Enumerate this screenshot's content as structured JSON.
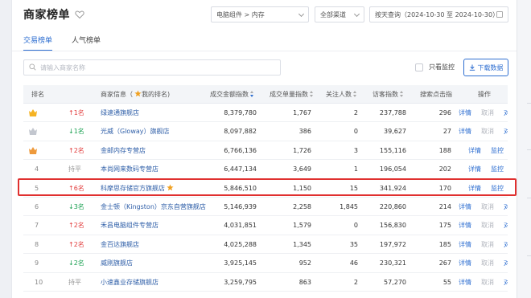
{
  "header": {
    "title": "商家榜单"
  },
  "filters": {
    "category": "电脑组件 > 内存",
    "channel": "全部渠道",
    "date": "按天查询（2024-10-30 至 2024-10-30）"
  },
  "tabs": [
    {
      "label": "交易榜单",
      "active": true
    },
    {
      "label": "人气榜单",
      "active": false
    }
  ],
  "search": {
    "placeholder": "请输入商家名称"
  },
  "toolbar": {
    "monitor_label": "只看监控",
    "download_label": "下载数据"
  },
  "table": {
    "columns": {
      "rank": "排名",
      "store": "商家信息（",
      "store_suffix": "我的排名)",
      "trade_index": "成交金额指数",
      "volume_index": "成交单量指数",
      "follow": "关注人数",
      "visitor_index": "访客指数",
      "click_index": "搜索点击指",
      "ops": "操作"
    },
    "rows": [
      {
        "rank": "1",
        "medal": "gold",
        "change": "1名",
        "dir": "up",
        "store": "绿速通旗舰店",
        "trade": "8,379,780",
        "volume": "1,767",
        "follow": "2",
        "visitor": "237,788",
        "click": "296",
        "actions": [
          "详情",
          "取消",
          "对比"
        ]
      },
      {
        "rank": "2",
        "medal": "silver",
        "change": "1名",
        "dir": "down",
        "store": "光威（Gloway）旗舰店",
        "trade": "8,097,882",
        "volume": "386",
        "follow": "0",
        "visitor": "39,627",
        "click": "27",
        "actions": [
          "详情",
          "取消",
          "对比"
        ]
      },
      {
        "rank": "3",
        "medal": "bronze",
        "change": "2名",
        "dir": "up",
        "store": "金邮内存专营店",
        "trade": "6,766,136",
        "volume": "1,726",
        "follow": "3",
        "visitor": "155,116",
        "click": "188",
        "actions": [
          "详情",
          "监控"
        ]
      },
      {
        "rank": "4",
        "medal": "",
        "change": "持平",
        "dir": "flat",
        "store": "本尚网来数码专营店",
        "trade": "6,447,134",
        "volume": "3,649",
        "follow": "1",
        "visitor": "196,054",
        "click": "202",
        "actions": [
          "详情",
          "监控"
        ]
      },
      {
        "rank": "5",
        "medal": "",
        "change": "6名",
        "dir": "up",
        "store": "科摩思存储官方旗舰店",
        "star": true,
        "trade": "5,846,510",
        "volume": "1,150",
        "follow": "15",
        "visitor": "341,924",
        "click": "170",
        "actions": [
          "详情",
          "监控"
        ]
      },
      {
        "rank": "6",
        "medal": "",
        "change": "3名",
        "dir": "down",
        "store": "金士顿（Kingston）京东自营旗舰店",
        "trade": "5,146,939",
        "volume": "2,258",
        "follow": "1,845",
        "visitor": "220,860",
        "click": "214",
        "actions": [
          "详情",
          "取消",
          "对比"
        ]
      },
      {
        "rank": "7",
        "medal": "",
        "change": "2名",
        "dir": "up",
        "store": "禾昌电脑组件专营店",
        "trade": "4,031,851",
        "volume": "1,579",
        "follow": "0",
        "visitor": "156,830",
        "click": "175",
        "actions": [
          "详情",
          "取消",
          "对比"
        ]
      },
      {
        "rank": "8",
        "medal": "",
        "change": "2名",
        "dir": "up",
        "store": "金百达旗舰店",
        "trade": "4,025,288",
        "volume": "1,345",
        "follow": "35",
        "visitor": "197,972",
        "click": "185",
        "actions": [
          "详情",
          "取消",
          "对比"
        ]
      },
      {
        "rank": "9",
        "medal": "",
        "change": "2名",
        "dir": "down",
        "store": "威刚旗舰店",
        "trade": "3,925,145",
        "volume": "952",
        "follow": "46",
        "visitor": "230,321",
        "click": "267",
        "actions": [
          "详情",
          "取消",
          "对比"
        ]
      },
      {
        "rank": "10",
        "medal": "",
        "change": "持平",
        "dir": "flat",
        "store": "小速鑫业存储旗舰店",
        "trade": "3,259,795",
        "volume": "863",
        "follow": "2",
        "visitor": "57,270",
        "click": "55",
        "actions": [
          "详情",
          "取消",
          "对比"
        ]
      }
    ]
  },
  "colors": {
    "accent": "#2f6fd1",
    "up": "#e23b3b",
    "down": "#1aa051",
    "highlight": "#e0302f"
  }
}
